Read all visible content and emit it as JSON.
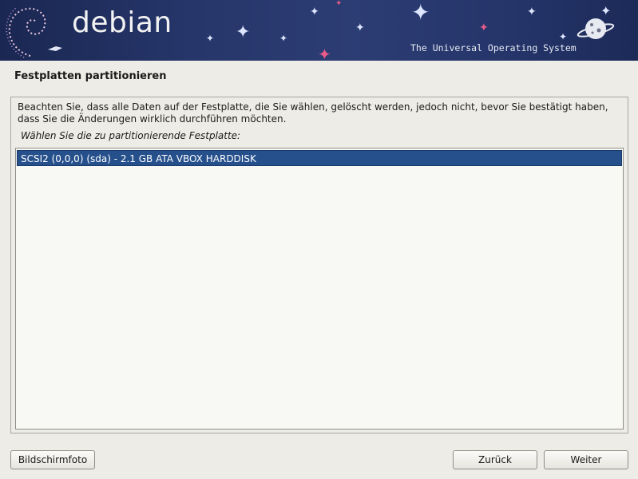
{
  "header": {
    "logo_text": "debian",
    "tagline": "The Universal Operating System"
  },
  "page": {
    "title": "Festplatten partitionieren",
    "info_text": "Beachten Sie, dass alle Daten auf der Festplatte, die Sie wählen, gelöscht werden, jedoch nicht, bevor Sie bestätigt haben, dass Sie die Änderungen wirklich durchführen möchten.",
    "prompt": "Wählen Sie die zu partitionierende Festplatte:"
  },
  "disk_list": {
    "items": [
      {
        "label": "SCSI2 (0,0,0) (sda) - 2.1 GB ATA VBOX HARDDISK",
        "selected": true
      }
    ]
  },
  "buttons": {
    "screenshot": "Bildschirmfoto",
    "back": "Zurück",
    "continue": "Weiter"
  },
  "colors": {
    "banner_bg": "#26366a",
    "selection": "#26508c",
    "window_bg": "#edece6"
  }
}
